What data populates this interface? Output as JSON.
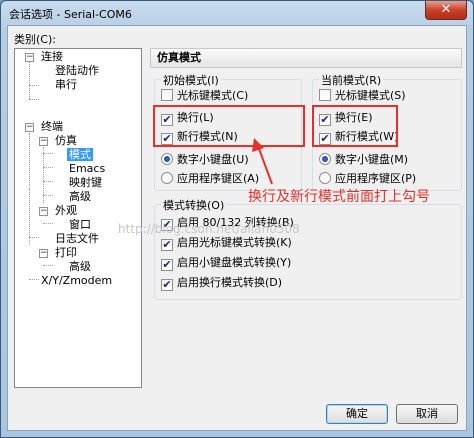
{
  "window": {
    "title": "会话选项 - Serial-COM6",
    "close_glyph": "✕"
  },
  "category_label": "类别(C):",
  "tree": {
    "items": [
      {
        "label": "连接",
        "toggle": "−"
      },
      {
        "label": "登陆动作"
      },
      {
        "label": "串行"
      },
      {
        "label": "终端",
        "toggle": "−"
      },
      {
        "label": "仿真",
        "toggle": "−"
      },
      {
        "label": "模式"
      },
      {
        "label": "Emacs"
      },
      {
        "label": "映射键"
      },
      {
        "label": "高级"
      },
      {
        "label": "外观",
        "toggle": "−"
      },
      {
        "label": "窗口"
      },
      {
        "label": "日志文件"
      },
      {
        "label": "打印",
        "toggle": "−"
      },
      {
        "label": "高级"
      },
      {
        "label": "X/Y/Zmodem"
      }
    ],
    "selected_index": 5
  },
  "panel_title": "仿真模式",
  "initial_mode": {
    "title": "初始模式(I)",
    "checkboxes": [
      {
        "label": "光标键模式(C)",
        "checked": false
      },
      {
        "label": "换行(L)",
        "checked": true
      },
      {
        "label": "新行模式(N)",
        "checked": true
      }
    ],
    "radios": [
      {
        "label": "数字小键盘(U)",
        "selected": true
      },
      {
        "label": "应用程序键区(A)",
        "selected": false
      }
    ]
  },
  "current_mode": {
    "title": "当前模式(R)",
    "checkboxes": [
      {
        "label": "光标键模式(S)",
        "checked": false
      },
      {
        "label": "换行(E)",
        "checked": true
      },
      {
        "label": "新行模式(W)",
        "checked": true
      }
    ],
    "radios": [
      {
        "label": "数字小键盘(M)",
        "selected": true
      },
      {
        "label": "应用程序键区(P)",
        "selected": false
      }
    ]
  },
  "mode_switch": {
    "title": "模式转换(O)",
    "checkboxes": [
      {
        "label": "启用 80/132 列转换(B)",
        "checked": true
      },
      {
        "label": "启用光标键模式转换(K)",
        "checked": true
      },
      {
        "label": "启用小键盘模式转换(Y)",
        "checked": true
      },
      {
        "label": "启用换行模式转换(D)",
        "checked": true
      }
    ]
  },
  "annotation_text": "换行及新行模式前面打上勾号",
  "watermark_text": "http://blog.csdn.net/allan0508",
  "check_glyph": "✔",
  "buttons": {
    "ok": "确定",
    "cancel": "取消"
  },
  "colors": {
    "annotation": "#e8302a",
    "selection": "#3399ff"
  }
}
